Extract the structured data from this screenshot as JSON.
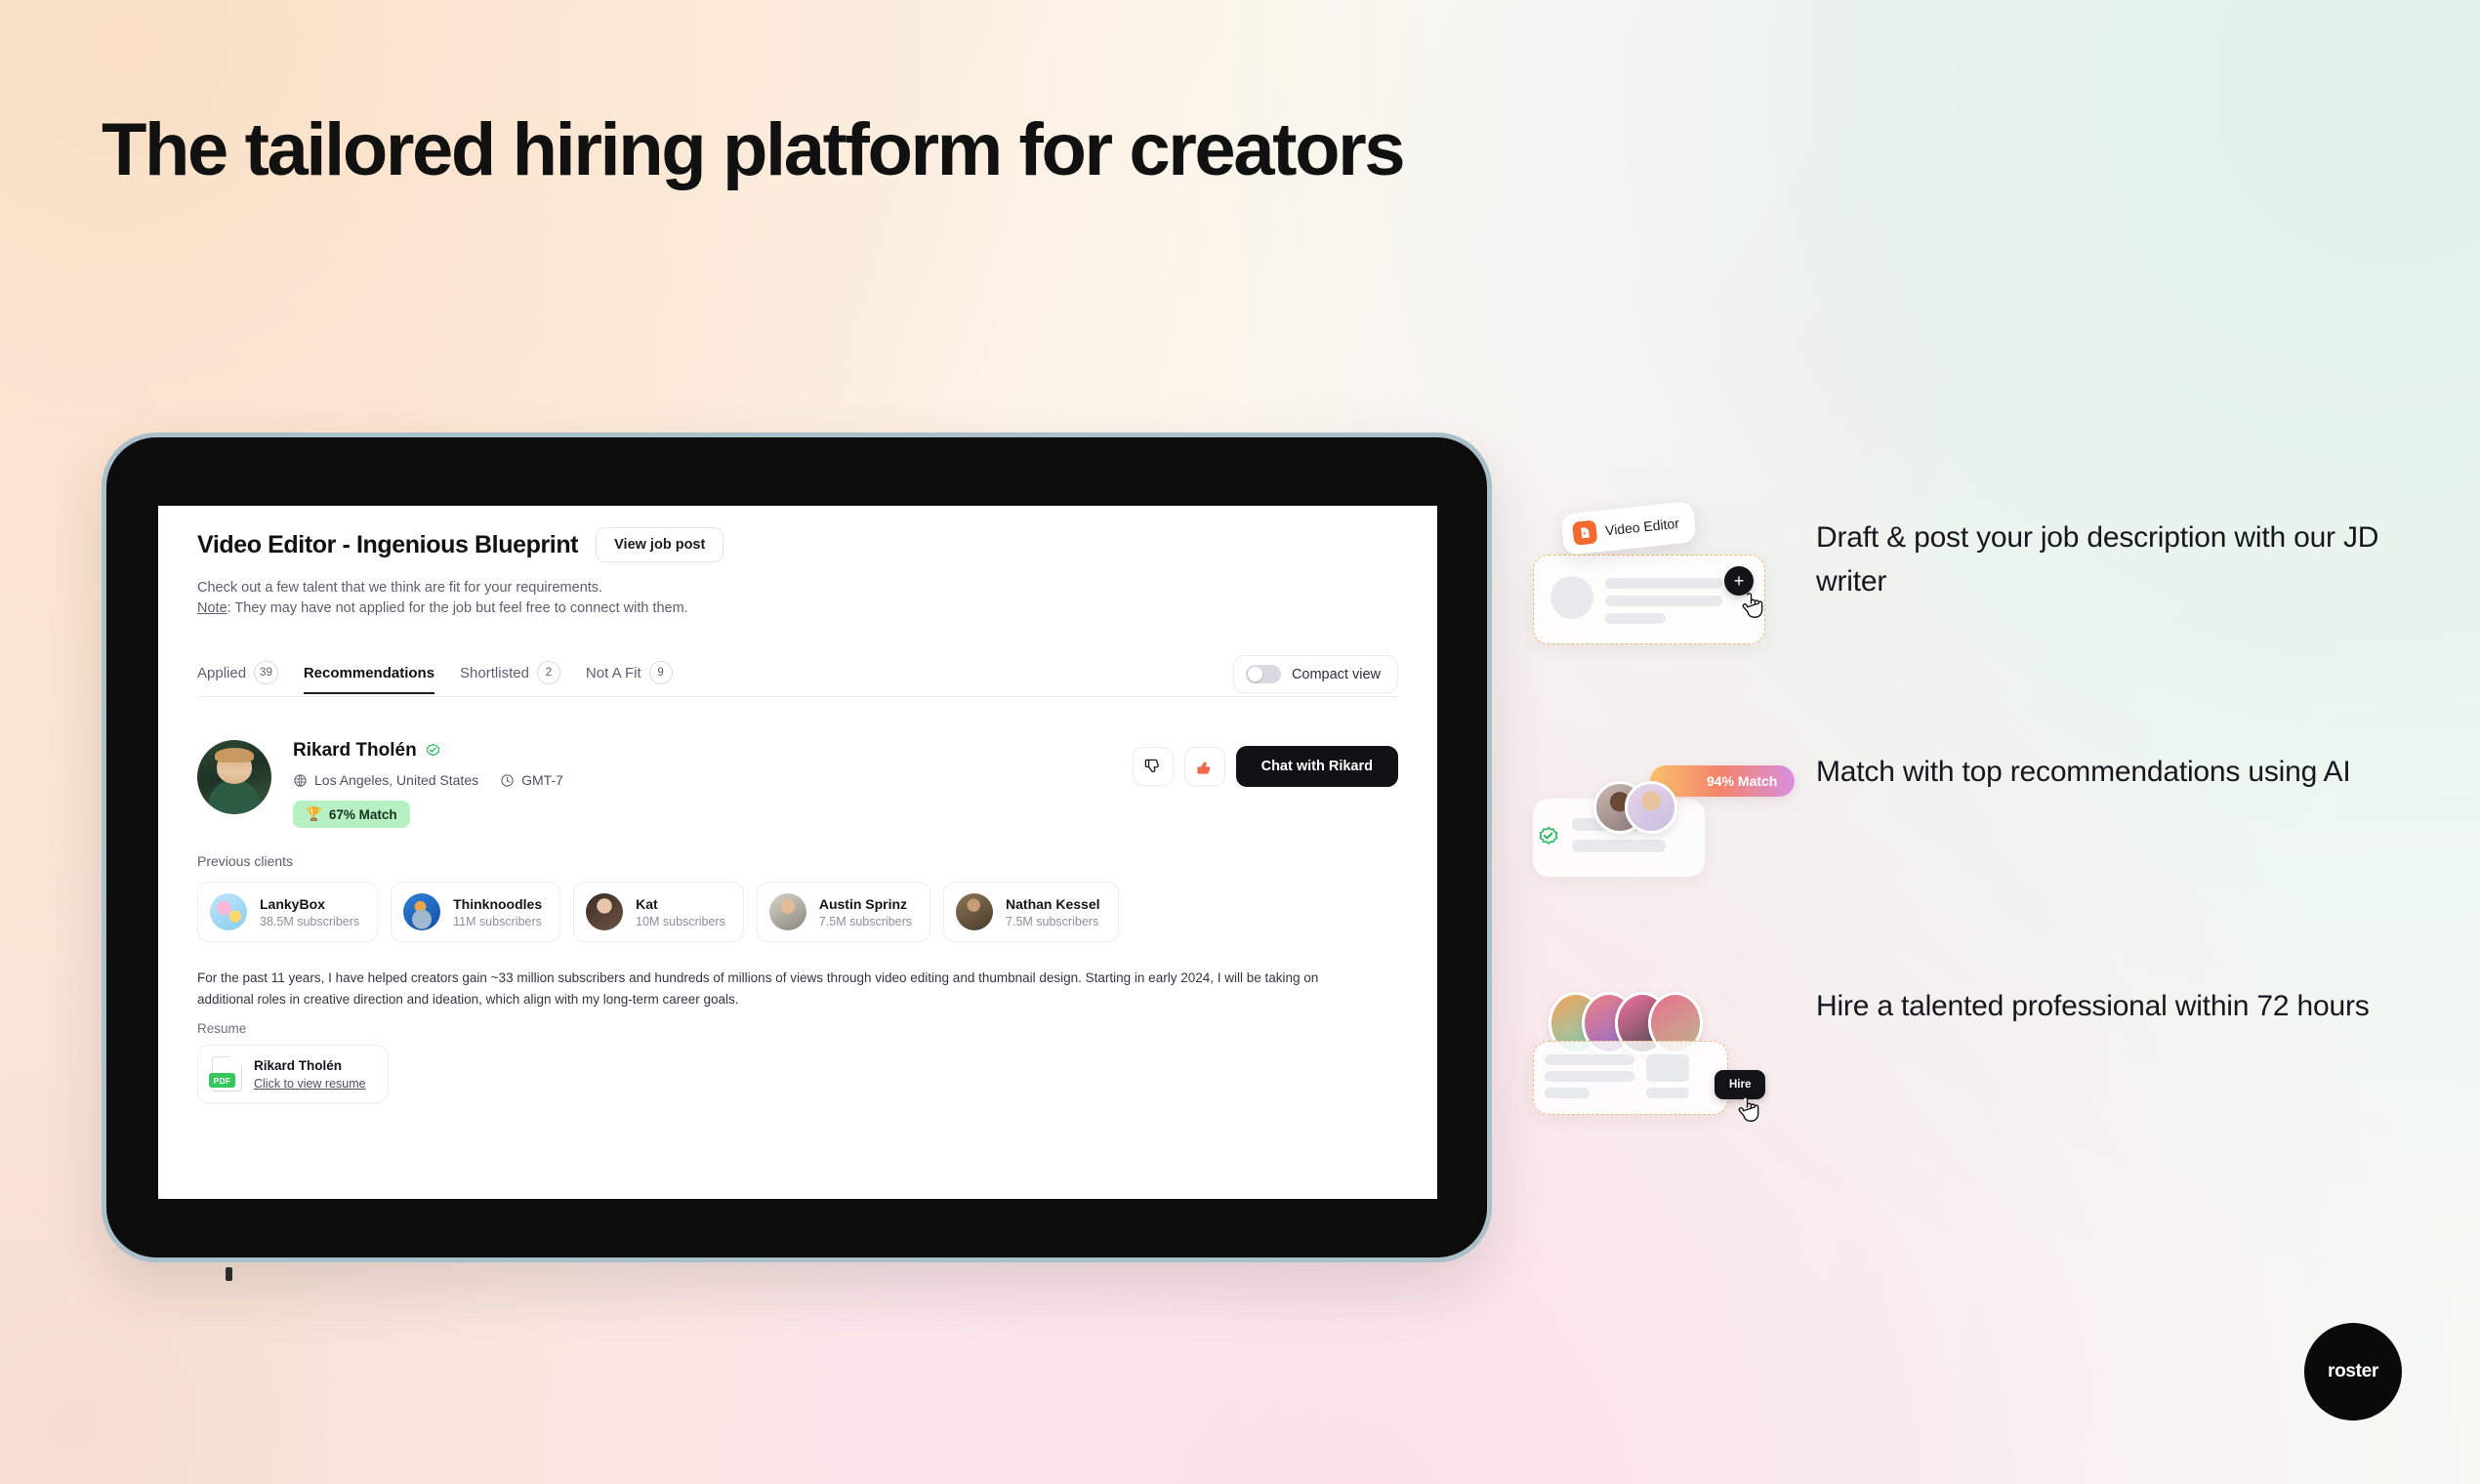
{
  "headline": "The tailored hiring platform for creators",
  "job": {
    "title": "Video Editor - Ingenious Blueprint",
    "view_job_post_label": "View job post",
    "subtitle": "Check out a few talent that we think are fit for your requirements.",
    "note_word": "Note",
    "note_rest": ": They may have not applied for the job but feel free to connect with them."
  },
  "tabs": [
    {
      "label": "Applied",
      "count": "39",
      "active": false
    },
    {
      "label": "Recommendations",
      "count": "",
      "active": true
    },
    {
      "label": "Shortlisted",
      "count": "2",
      "active": false
    },
    {
      "label": "Not A Fit",
      "count": "9",
      "active": false
    }
  ],
  "compact_view": {
    "label": "Compact view",
    "enabled": false
  },
  "candidate": {
    "name": "Rikard Tholén",
    "verified": true,
    "location": "Los Angeles, United States",
    "timezone": "GMT-7",
    "match": "67% Match",
    "match_icon": "trophy-icon",
    "actions": {
      "thumbs_down": "thumbs-down-icon",
      "thumbs_up": "thumbs-up-icon",
      "chat_label": "Chat with Rikard"
    },
    "previous_clients_label": "Previous clients",
    "previous_clients": [
      {
        "name": "LankyBox",
        "subscribers": "38.5M subscribers"
      },
      {
        "name": "Thinknoodles",
        "subscribers": "11M subscribers"
      },
      {
        "name": "Kat",
        "subscribers": "10M subscribers"
      },
      {
        "name": "Austin Sprinz",
        "subscribers": "7.5M subscribers"
      },
      {
        "name": "Nathan Kessel",
        "subscribers": "7.5M subscribers"
      }
    ],
    "bio": "For the past 11 years, I have helped creators gain ~33 million subscribers and hundreds of millions of views through video editing and thumbnail design. Starting in early 2024, I will be taking on additional roles in creative direction and ideation, which align with my long-term career goals.",
    "resume_label": "Resume",
    "resume": {
      "file_badge": "PDF",
      "name": "Rikard Tholén",
      "link_label": "Click to view resume"
    }
  },
  "features": [
    {
      "text": "Draft & post your job description with our JD writer",
      "chip_label": "Video Editor",
      "chip_icon": "video-file-icon",
      "plus_icon": "plus-icon",
      "cursor_icon": "hand-cursor-icon"
    },
    {
      "text": "Match with top recommendations using AI",
      "badge_label": "94% Match",
      "check_icon": "verified-check-icon"
    },
    {
      "text": "Hire a talented professional within 72 hours",
      "button_label": "Hire",
      "cursor_icon": "hand-cursor-icon"
    }
  ],
  "brand": {
    "name": "roster"
  },
  "colors": {
    "accent_black": "#111116",
    "match_green": "#b7f0c2",
    "thumbs_up_red": "#f4674f",
    "chip_orange": "#f26a2e",
    "pdf_green": "#34c759"
  }
}
